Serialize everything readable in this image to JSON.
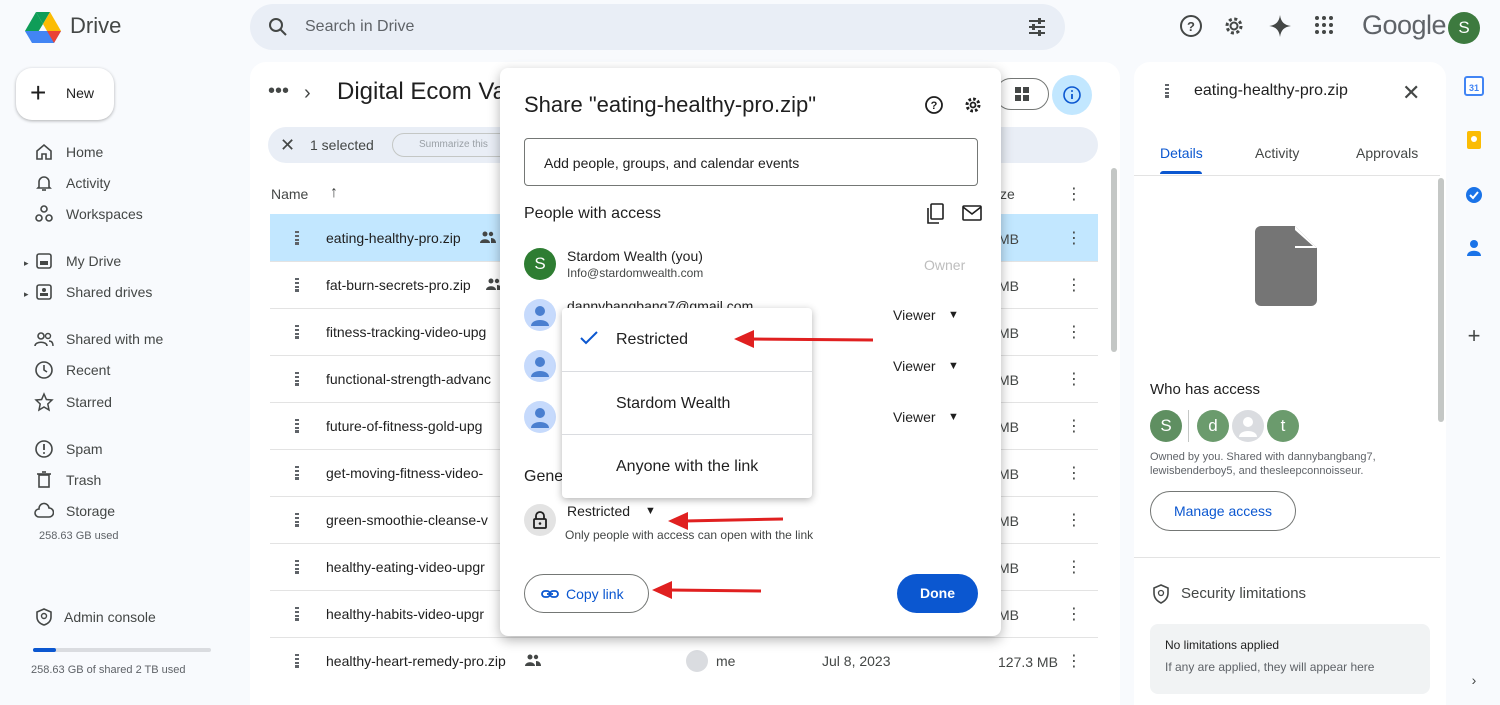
{
  "app": {
    "name": "Drive",
    "brand_word": "Google",
    "user_initial": "S"
  },
  "search": {
    "placeholder": "Search in Drive"
  },
  "nav": {
    "new_label": "New",
    "items": [
      {
        "label": "Home",
        "icon": "home-icon"
      },
      {
        "label": "Activity",
        "icon": "bell-icon"
      },
      {
        "label": "Workspaces",
        "icon": "workspaces-icon"
      },
      {
        "label": "My Drive",
        "icon": "my-drive-icon"
      },
      {
        "label": "Shared drives",
        "icon": "shared-drives-icon"
      },
      {
        "label": "Shared with me",
        "icon": "people-icon"
      },
      {
        "label": "Recent",
        "icon": "clock-icon"
      },
      {
        "label": "Starred",
        "icon": "star-icon"
      },
      {
        "label": "Spam",
        "icon": "spam-icon"
      },
      {
        "label": "Trash",
        "icon": "trash-icon"
      },
      {
        "label": "Storage",
        "icon": "cloud-icon"
      }
    ],
    "storage_used": "258.63 GB used",
    "admin_console": "Admin console",
    "storage_shared": "258.63 GB of shared 2 TB used",
    "storage_fraction": 0.13
  },
  "main": {
    "folder_title": "Digital Ecom Va",
    "selected_text": "1 selected",
    "summarize_label": "Summarize this",
    "columns": {
      "name": "Name",
      "size": "ze"
    },
    "files": [
      {
        "name": "eating-healthy-pro.zip",
        "size": "MB",
        "selected": true,
        "shared": true
      },
      {
        "name": "fat-burn-secrets-pro.zip",
        "size": "MB",
        "shared": true
      },
      {
        "name": "fitness-tracking-video-upg",
        "size": "MB"
      },
      {
        "name": "functional-strength-advanc",
        "size": "MB"
      },
      {
        "name": "future-of-fitness-gold-upg",
        "size": "MB"
      },
      {
        "name": "get-moving-fitness-video-",
        "size": "MB"
      },
      {
        "name": "green-smoothie-cleanse-v",
        "size": "MB"
      },
      {
        "name": "healthy-eating-video-upgr",
        "size": "MB"
      },
      {
        "name": "healthy-habits-video-upgr",
        "size": "MB"
      },
      {
        "name": "healthy-heart-remedy-pro.zip",
        "size": "127.3 MB",
        "shared": true,
        "owner": "me",
        "date": "Jul 8, 2023"
      }
    ]
  },
  "details": {
    "title": "eating-healthy-pro.zip",
    "tabs": [
      "Details",
      "Activity",
      "Approvals"
    ],
    "who_has_access": "Who has access",
    "avatars": [
      {
        "initial": "S",
        "color": "#5f8f61"
      },
      {
        "initial": "d",
        "color": "#6b9b6d"
      },
      {
        "initial": "",
        "color": "#dadce0"
      },
      {
        "initial": "t",
        "color": "#6b9b6d"
      }
    ],
    "owned_text": "Owned by you. Shared with dannybangbang7, lewisbenderboy5, and thesleepconnoisseur.",
    "manage_access": "Manage access",
    "security_title": "Security limitations",
    "no_limitations": "No limitations applied",
    "if_any": "If any are applied, they will appear here"
  },
  "dialog": {
    "title": "Share \"eating-healthy-pro.zip\"",
    "add_placeholder": "Add people, groups, and calendar events",
    "people_with_access": "People with access",
    "people": [
      {
        "name": "Stardom Wealth (you)",
        "email": "Info@stardomwealth.com",
        "role": "Owner",
        "initial": "S"
      },
      {
        "name": "dannybangbang7@gmail.com",
        "role": "Viewer"
      },
      {
        "role": "Viewer"
      },
      {
        "role": "Viewer"
      }
    ],
    "general_access": "Gene",
    "restricted": "Restricted",
    "restricted_desc": "Only people with access can open with the link",
    "copy_link": "Copy link",
    "done": "Done"
  },
  "menu": {
    "options": [
      "Restricted",
      "Stardom Wealth",
      "Anyone with the link"
    ],
    "selected": "Restricted"
  },
  "colors": {
    "accent": "#0b57d0",
    "selected_row": "#c2e7ff",
    "arrow": "#e02020"
  }
}
